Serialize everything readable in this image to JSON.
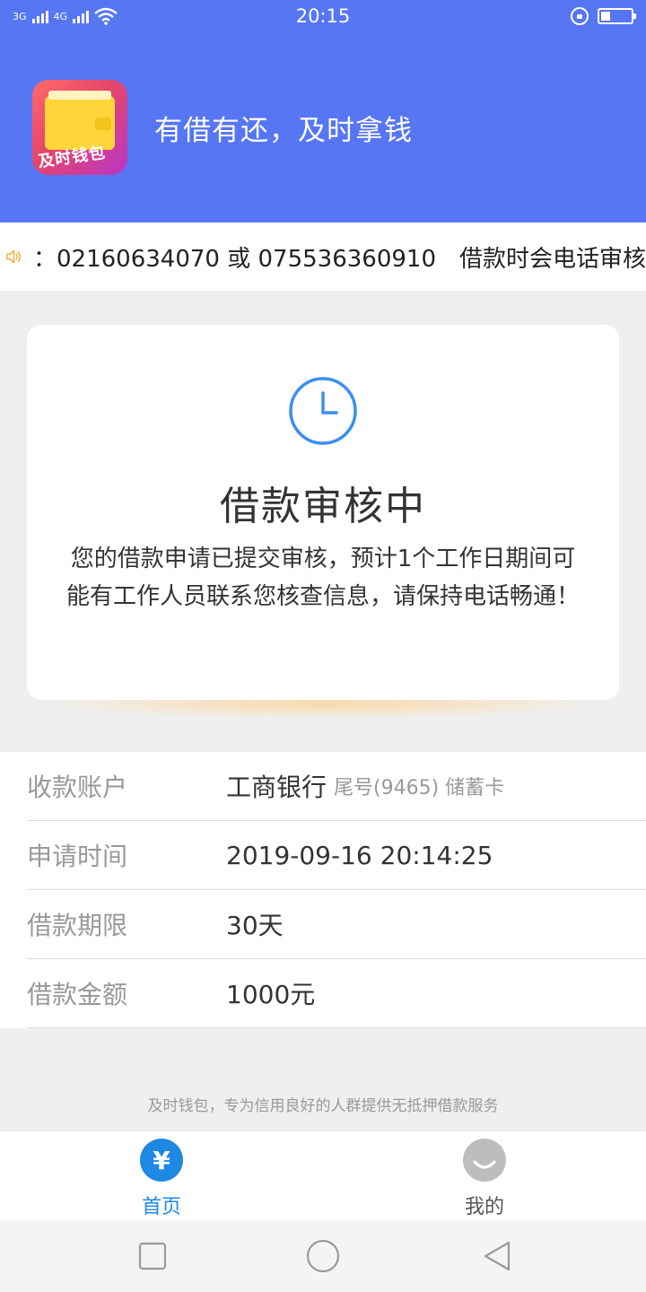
{
  "status_bar": {
    "network_1": "3G",
    "network_2": "4G",
    "time": "20:15",
    "battery_level": 0.3
  },
  "header": {
    "logo_text": "及时钱包",
    "slogan": "有借有还，及时拿钱"
  },
  "notice": {
    "icon": "speaker-icon",
    "text": "：02160634070 或 075536360910　借款时会电话审核"
  },
  "status_card": {
    "icon": "clock-icon",
    "title": "借款审核中",
    "description": "您的借款申请已提交审核，预计1个工作日期间可能有工作人员联系您核查信息，请保持电话畅通！"
  },
  "details": {
    "rows": [
      {
        "label": "收款账户",
        "value": "工商银行",
        "sub": "尾号(9465) 储蓄卡"
      },
      {
        "label": "申请时间",
        "value": "2019-09-16 20:14:25"
      },
      {
        "label": "借款期限",
        "value": "30天"
      },
      {
        "label": "借款金额",
        "value": "1000元"
      }
    ]
  },
  "footer_note": "及时钱包，专为信用良好的人群提供无抵押借款服务",
  "tabs": [
    {
      "label": "首页",
      "icon": "yuan-icon",
      "glyph": "¥",
      "active": true
    },
    {
      "label": "我的",
      "icon": "profile-icon",
      "active": false
    }
  ],
  "colors": {
    "brand": "#5676f4",
    "tab_active": "#1e88e5",
    "tab_inactive": "#bdbdbd",
    "clock": "#3b8ff0",
    "speaker": "#f5a623"
  }
}
